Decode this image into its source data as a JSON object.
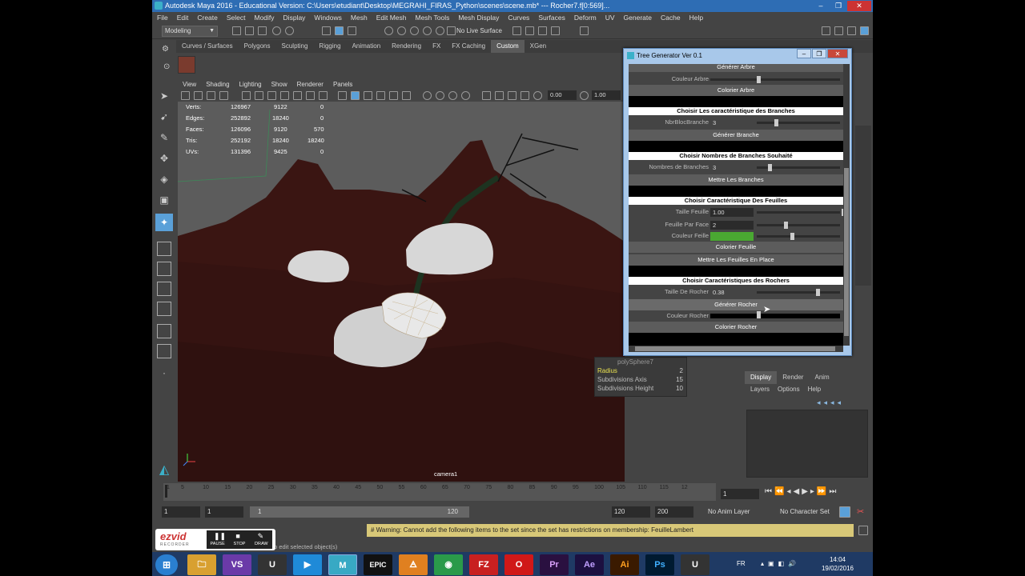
{
  "window": {
    "title": "Autodesk Maya 2016 - Educational Version: C:\\Users\\etudiant\\Desktop\\MEGRAHI_FIRAS_Python\\scenes\\scene.mb*   ---   Rocher7.f[0:569]...",
    "buttons": [
      "‒",
      "❐",
      "✕"
    ]
  },
  "menubar": [
    "File",
    "Edit",
    "Create",
    "Select",
    "Modify",
    "Display",
    "Windows",
    "Mesh",
    "Edit Mesh",
    "Mesh Tools",
    "Mesh Display",
    "Curves",
    "Surfaces",
    "Deform",
    "UV",
    "Generate",
    "Cache",
    "Help"
  ],
  "statusline": {
    "mode": "Modeling",
    "live_surface": "No Live Surface"
  },
  "shelf": {
    "tabs": [
      "Curves / Surfaces",
      "Polygons",
      "Sculpting",
      "Rigging",
      "Animation",
      "Rendering",
      "FX",
      "FX Caching",
      "Custom",
      "XGen"
    ],
    "active_tab": "Custom"
  },
  "viewport": {
    "menu": [
      "View",
      "Shading",
      "Lighting",
      "Show",
      "Renderer",
      "Panels"
    ],
    "toolbar_values": {
      "value_a": "0.00",
      "value_b": "1.00"
    },
    "hud": [
      {
        "label": "Verts:",
        "c1": "126967",
        "c2": "9122",
        "c3": "0"
      },
      {
        "label": "Edges:",
        "c1": "252892",
        "c2": "18240",
        "c3": "0"
      },
      {
        "label": "Faces:",
        "c1": "126096",
        "c2": "9120",
        "c3": "570"
      },
      {
        "label": "Tris:",
        "c1": "252192",
        "c2": "18240",
        "c3": "18240"
      },
      {
        "label": "UVs:",
        "c1": "131396",
        "c2": "9425",
        "c3": "0"
      }
    ],
    "camera": "camera1"
  },
  "channel_box": {
    "title": "polySphere7",
    "rows": [
      {
        "label": "Radius",
        "value": "2"
      },
      {
        "label": "Subdivisions Axis",
        "value": "15"
      },
      {
        "label": "Subdivisions Height",
        "value": "10"
      }
    ]
  },
  "layer_editor": {
    "tabs": [
      "Display",
      "Render",
      "Anim"
    ],
    "menu": [
      "Layers",
      "Options",
      "Help"
    ]
  },
  "timeline": {
    "ticks": [
      "1",
      "5",
      "10",
      "15",
      "20",
      "25",
      "30",
      "35",
      "40",
      "45",
      "50",
      "55",
      "60",
      "65",
      "70",
      "75",
      "80",
      "85",
      "90",
      "95",
      "100",
      "105",
      "110",
      "115",
      "12"
    ],
    "current_frame": "1"
  },
  "range": {
    "start": "1",
    "playback_start": "1",
    "slider_start": "1",
    "slider_end": "120",
    "playback_end": "120",
    "end": "200",
    "anim_layer": "No Anim Layer",
    "char_set": "No Character Set"
  },
  "command": {
    "warning": "# Warning: Cannot add the following items to the set since the set has restrictions on membership: FeuilleLambert",
    "help": "to edit selected object(s)"
  },
  "recorder": {
    "brand": "ezvid",
    "sub": "RECORDER",
    "controls": [
      "PAUSE",
      "STOP",
      "DRAW"
    ]
  },
  "taskbar": {
    "apps": [
      "⊞",
      "🗀",
      "VS",
      "U",
      "▶",
      "M",
      "EPIC",
      "🜁",
      "◉",
      "FZ",
      "O",
      "Pr",
      "Ae",
      "Ai",
      "Ps",
      "U"
    ],
    "lang": "FR",
    "time": "14:04",
    "date": "19/02/2016"
  },
  "tree_window": {
    "title": "Tree Generator Ver 0.1",
    "sections": {
      "btn_generer_arbre": "Générer Arbre",
      "lbl_couleur_arbre": "Couleur Arbre",
      "btn_colorier_arbre": "Colorier Arbre",
      "hdr_branches": "Choisir Les caractéristique des Branches",
      "lbl_nbr_bloc": "NbrBlocBranche",
      "val_nbr_bloc": "3",
      "btn_generer_branche": "Générer Branche",
      "hdr_nombres": "Choisir Nombres de Branches Souhaité",
      "lbl_nombres": "Nombres de Branches",
      "val_nombres": "3",
      "btn_mettre_branches": "Mettre Les Branches",
      "hdr_feuilles": "Choisir Caractéristique Des Feuilles",
      "lbl_taille_feuille": "Taille Feuille",
      "val_taille_feuille": "1.00",
      "lbl_feuille_par_face": "Feuille Par Face",
      "val_feuille_par_face": "2",
      "lbl_couleur_feuille": "Couleur Feille",
      "btn_colorier_feuille": "Colorier Feuille",
      "btn_mettre_feuilles": "Mettre Les Feuilles En Place",
      "hdr_rochers": "Choisir Caractéristiques des Rochers",
      "lbl_taille_rocher": "Taille De Rocher",
      "val_taille_rocher": "0.38",
      "btn_generer_rocher": "Générer Rocher",
      "lbl_couleur_rocher": "Couleur Rocher",
      "btn_colorier_rocher": "Colorier Rocher"
    },
    "colors": {
      "leaf": "#4aa832",
      "rock": "#000000"
    }
  },
  "colors": {
    "accent": "#5aa0d8",
    "titlebar": "#2e6db4",
    "warning_bg": "#d8c878",
    "ground": "#3a1512"
  }
}
